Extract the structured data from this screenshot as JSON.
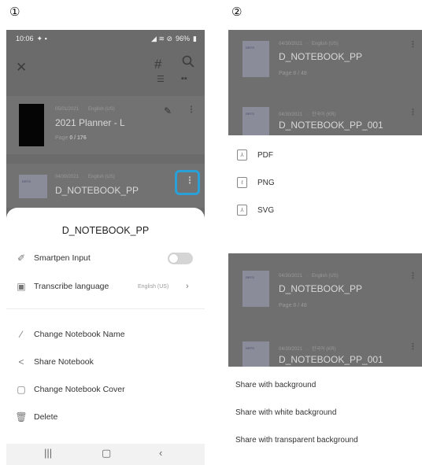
{
  "steps": {
    "one": "①",
    "two": "②"
  },
  "status_bar": {
    "time": "10:06",
    "battery": "96%"
  },
  "list": {
    "card1": {
      "date": "05/01/2021",
      "lang": "English (US)",
      "title": "2021 Planner - L",
      "page_label": "Page",
      "page_value": "0 / 176"
    },
    "card2": {
      "date": "04/30/2021",
      "lang": "English (US)",
      "title": "D_NOTEBOOK_PP"
    }
  },
  "sheet": {
    "title": "D_NOTEBOOK_PP",
    "smartpen_input": "Smartpen Input",
    "transcribe_language": "Transcribe language",
    "transcribe_value": "English (US)",
    "change_name": "Change Notebook Name",
    "share": "Share Notebook",
    "change_cover": "Change Notebook Cover",
    "delete": "Delete"
  },
  "panel_top": {
    "card1": {
      "date": "04/30/2021",
      "lang": "English (US)",
      "title": "D_NOTEBOOK_PP",
      "page": "Page 8 / 48"
    },
    "card2": {
      "date": "04/30/2021",
      "lang": "한국어 (KR)",
      "title": "D_NOTEBOOK_PP_001"
    },
    "menu": [
      "PDF",
      "PNG",
      "SVG"
    ]
  },
  "panel_bottom": {
    "card1": {
      "date": "04/30/2021",
      "lang": "English (US)",
      "title": "D_NOTEBOOK_PP",
      "page": "Page 8 / 48"
    },
    "card2": {
      "date": "04/30/2021",
      "lang": "한국어 (KR)",
      "title": "D_NOTEBOOK_PP_001"
    },
    "menu": [
      "Share with background",
      "Share with white background",
      "Share with transparent background"
    ]
  },
  "colors": {
    "overlay": "#6b6b6b",
    "highlight": "#2aa0d8",
    "sheet": "#ffffff"
  }
}
